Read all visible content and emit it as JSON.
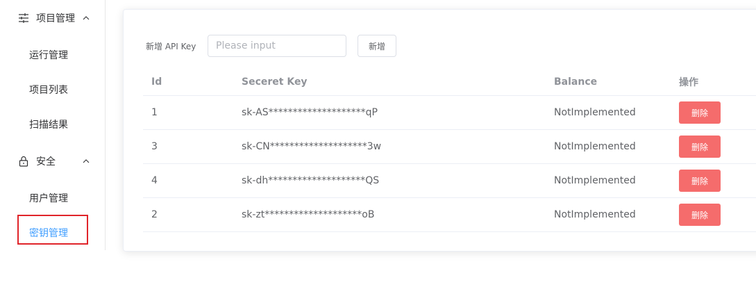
{
  "sidebar": {
    "groups": [
      {
        "label": "项目管理",
        "icon": "sliders-icon",
        "items": [
          "运行管理",
          "项目列表",
          "扫描结果"
        ]
      },
      {
        "label": "安全",
        "icon": "lock-icon",
        "items": [
          "用户管理",
          "密钥管理"
        ]
      }
    ],
    "active_item": "密钥管理"
  },
  "form": {
    "label": "新增 API Key",
    "input_placeholder": "Please input",
    "input_value": "",
    "add_button": "新增"
  },
  "table": {
    "headers": {
      "id": "Id",
      "key": "Seceret Key",
      "balance": "Balance",
      "op": "操作"
    },
    "rows": [
      {
        "id": "1",
        "key": "sk-AS********************qP",
        "balance": "NotImplemented",
        "action": "删除"
      },
      {
        "id": "3",
        "key": "sk-CN********************3w",
        "balance": "NotImplemented",
        "action": "删除"
      },
      {
        "id": "4",
        "key": "sk-dh********************QS",
        "balance": "NotImplemented",
        "action": "删除"
      },
      {
        "id": "2",
        "key": "sk-zt********************oB",
        "balance": "NotImplemented",
        "action": "删除"
      }
    ]
  },
  "colors": {
    "accent": "#409eff",
    "danger": "#f56c6c",
    "highlight": "#e0242a"
  }
}
